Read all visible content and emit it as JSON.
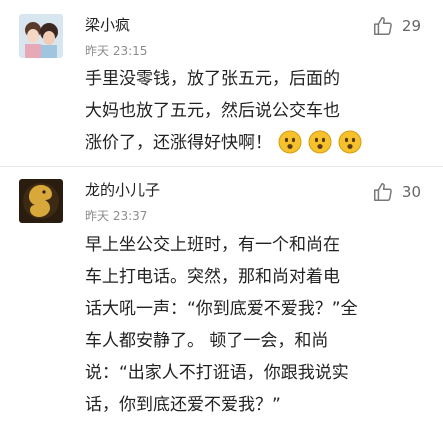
{
  "comments": [
    {
      "username": "梁小疯",
      "time": "昨天 23:15",
      "likes": "29",
      "text_lines": [
        "手里没零钱，放了张五元，后面的",
        "大妈也放了五元，然后说公交车也",
        "涨价了，还涨得好快啊！"
      ],
      "emojis": [
        "thinking-face-emoji",
        "thinking-face-emoji",
        "thinking-face-emoji"
      ]
    },
    {
      "username": "龙的小儿子",
      "time": "昨天 23:37",
      "likes": "30",
      "text_lines": [
        "早上坐公交上班时，有一个和尚在",
        "车上打电话。突然，那和尚对着电",
        "话大吼一声：“你到底爱不爱我？”全",
        "车人都安静了。 顿了一会，和尚",
        "说：“出家人不打诳语，你跟我说实",
        "话，你到底还爱不爱我？”"
      ]
    }
  ],
  "colors": {
    "username": "#222222",
    "meta": "#8c8c8c",
    "like_icon": "#777777",
    "divider": "#e6e6e6"
  }
}
